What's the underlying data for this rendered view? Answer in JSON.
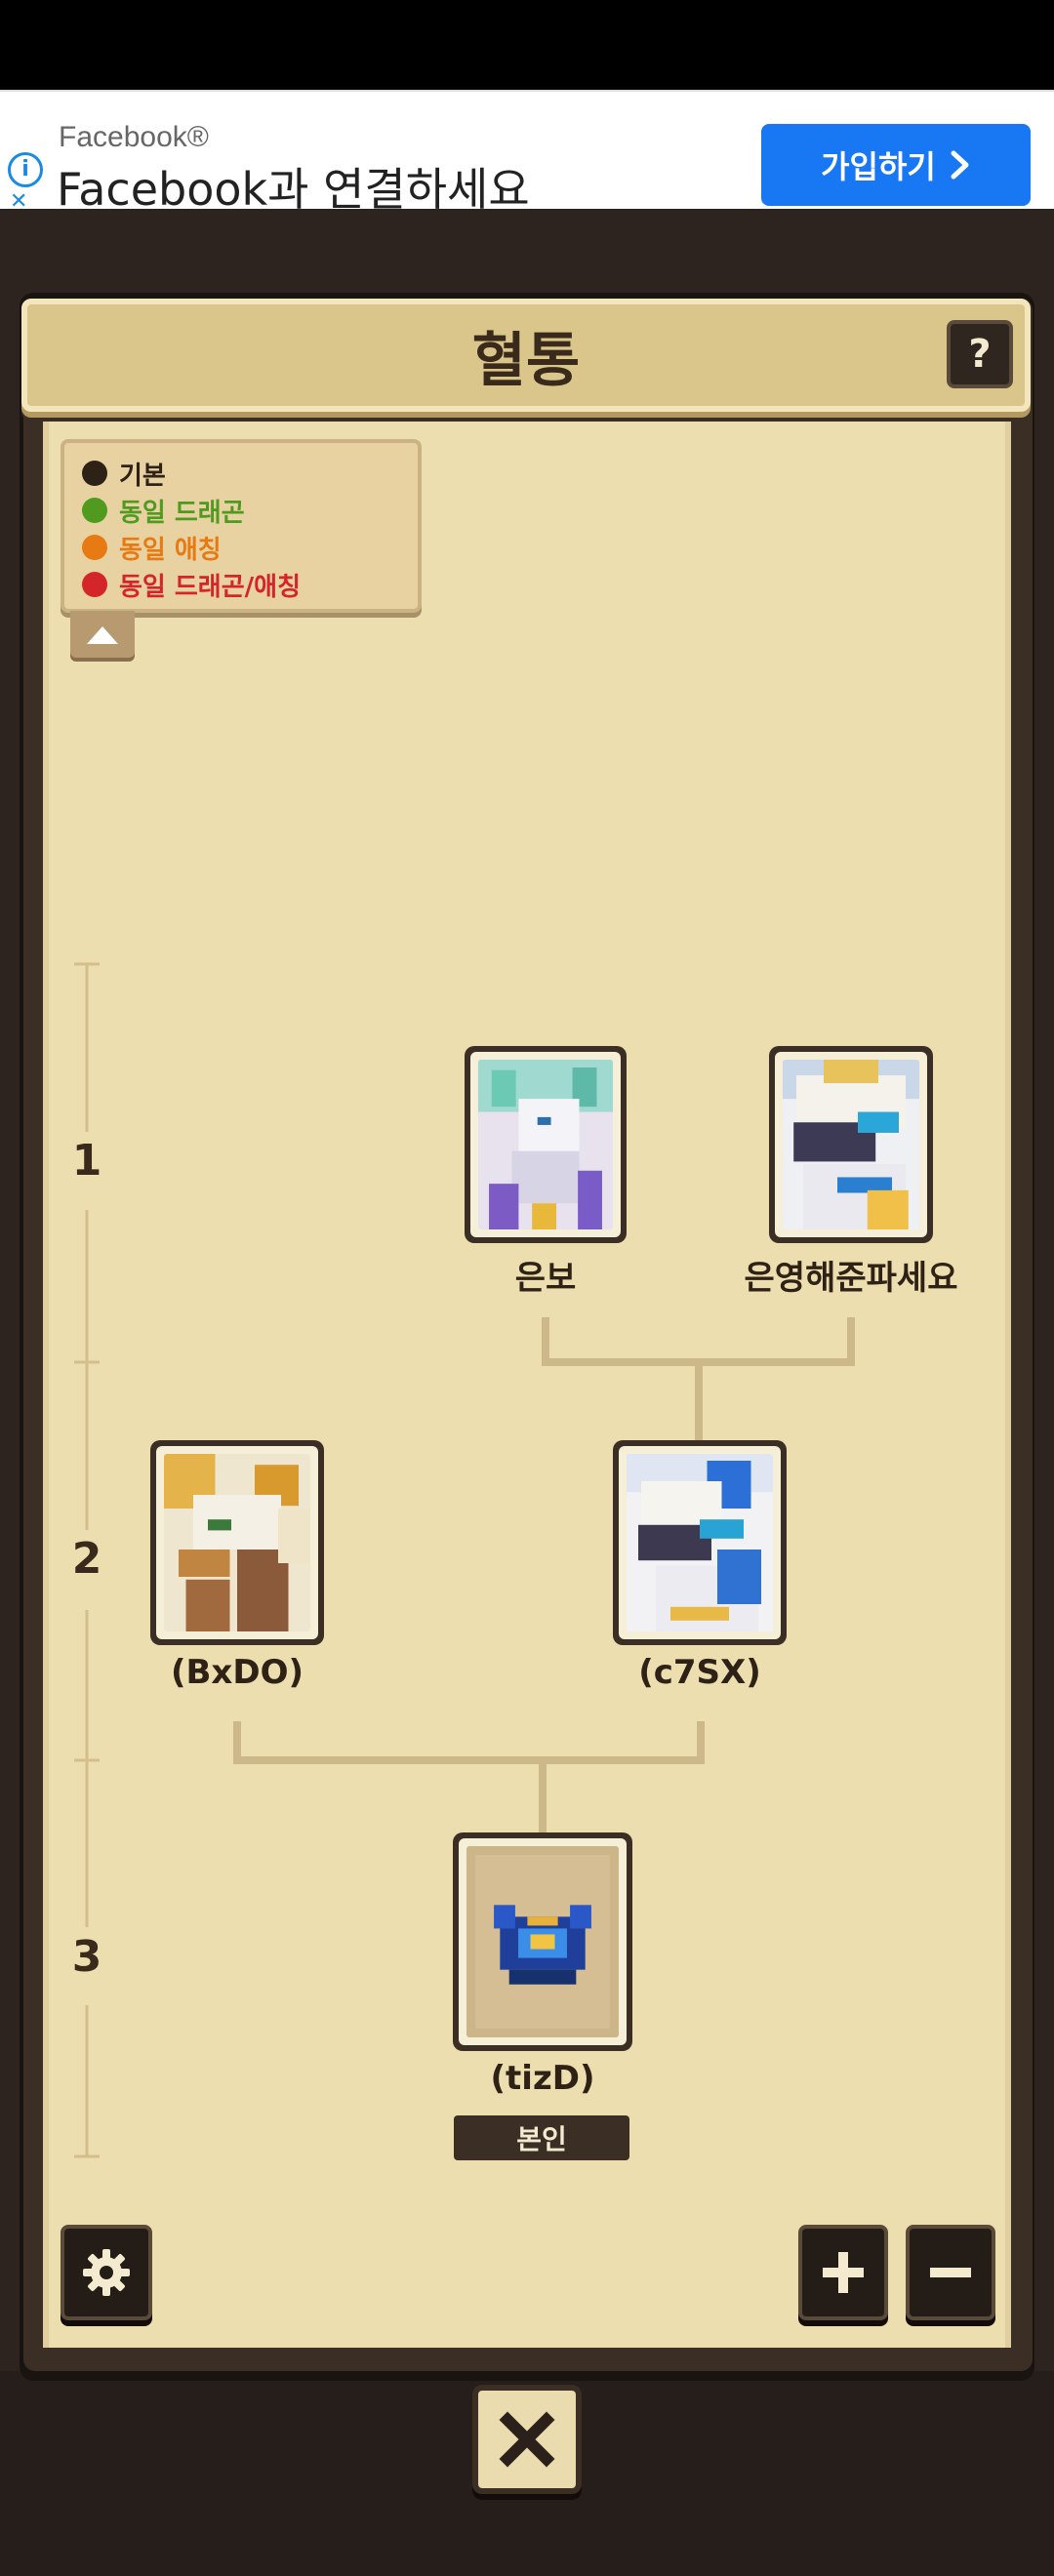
{
  "ad": {
    "brand": "Facebook®",
    "headline": "Facebook과 연결하세요",
    "cta_label": "가입하기",
    "info_icon": "info-icon",
    "close_icon": "close-icon"
  },
  "panel": {
    "title": "혈통",
    "help_label": "?"
  },
  "legend": {
    "items": [
      {
        "label": "기본",
        "color": "#2e2217"
      },
      {
        "label": "동일 드래곤",
        "color": "#4f9a1f"
      },
      {
        "label": "동일 애칭",
        "color": "#e77a12"
      },
      {
        "label": "동일 드래곤/애칭",
        "color": "#d4252b"
      }
    ]
  },
  "generations": [
    "1",
    "2",
    "3"
  ],
  "tree": {
    "gen1": [
      {
        "name": "은보"
      },
      {
        "name": "은영해준파세요"
      }
    ],
    "gen2": [
      {
        "name": "(BxDO)"
      },
      {
        "name": "(c7SX)"
      }
    ],
    "gen3": [
      {
        "name": "(tizD)",
        "badge": "본인"
      }
    ]
  },
  "controls": {
    "settings": "gear-icon",
    "zoom_in": "plus-icon",
    "zoom_out": "minus-icon",
    "close": "close-icon"
  }
}
